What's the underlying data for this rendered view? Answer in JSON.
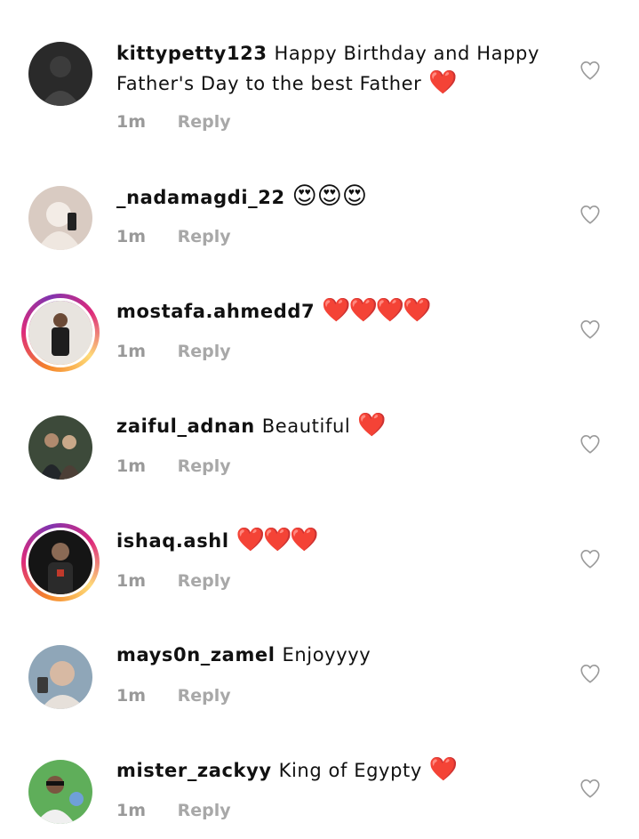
{
  "colors": {
    "heart": "#e0262b",
    "meta_text": "#999999",
    "story_ring_start": "#f58529",
    "story_ring_end": "#dd2a7b"
  },
  "icons": {
    "like": "heart-outline-icon",
    "emoji_heart": "red-heart",
    "emoji_face": "heart-eyes-face"
  },
  "comments": [
    {
      "username": "kittypetty123",
      "text": "Happy Birthday and Happy Father's Day to the best Father",
      "emoji": "❤️",
      "time": "1m",
      "reply": "Reply"
    },
    {
      "username": "_nadamagdi_22",
      "text": "",
      "emoji": "😍😍😍",
      "time": "1m",
      "reply": "Reply"
    },
    {
      "username": "mostafa.ahmedd7",
      "text": "",
      "emoji": "❤️❤️❤️❤️",
      "time": "1m",
      "reply": "Reply"
    },
    {
      "username": "zaiful_adnan",
      "text": "Beautiful",
      "emoji": "❤️",
      "time": "1m",
      "reply": "Reply"
    },
    {
      "username": "ishaq.ashl",
      "text": "",
      "emoji": "❤️❤️❤️",
      "time": "1m",
      "reply": "Reply"
    },
    {
      "username": "mays0n_zamel",
      "text": "Enjoyyyy",
      "emoji": "",
      "time": "1m",
      "reply": "Reply"
    },
    {
      "username": "mister_zackyy",
      "text": "King of Egypty",
      "emoji": "❤️",
      "time": "1m",
      "reply": "Reply"
    }
  ]
}
